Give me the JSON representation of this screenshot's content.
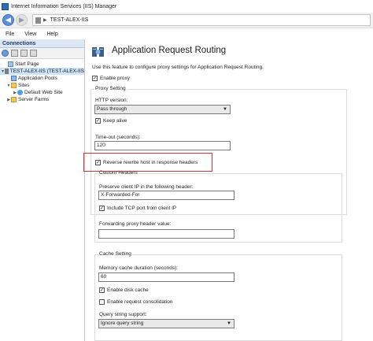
{
  "window": {
    "title": "Internet Information Services (IIS) Manager"
  },
  "address": {
    "path": "TEST-ALEX-IIS"
  },
  "menu": [
    "File",
    "View",
    "Help"
  ],
  "connections": {
    "header": "Connections",
    "tree": [
      {
        "label": "Start Page",
        "icon": "home-icon",
        "level": 1
      },
      {
        "label": "TEST-ALEX-IIS (TEST-ALEX-IIS",
        "icon": "server-icon",
        "level": 0,
        "expanded": true
      },
      {
        "label": "Application Pools",
        "icon": "app-pool-icon",
        "level": 1
      },
      {
        "label": "Sites",
        "icon": "folder-icon",
        "level": 1,
        "expanded": true
      },
      {
        "label": "Default Web Site",
        "icon": "globe-icon",
        "level": 2
      },
      {
        "label": "Server Farms",
        "icon": "folder-icon",
        "level": 1
      }
    ]
  },
  "page": {
    "title": "Application Request Routing",
    "description": "Use this feature to configure proxy settings for Application Request Routing.",
    "enable_proxy": {
      "label": "Enable proxy",
      "checked": true
    },
    "proxy_setting": {
      "legend": "Proxy Setting",
      "http_version_label": "HTTP version:",
      "http_version_value": "Pass through",
      "keep_alive": {
        "label": "Keep alive",
        "checked": true
      },
      "timeout_label": "Time-out (seconds):",
      "timeout_value": "120",
      "reverse_rewrite": {
        "label": "Reverse rewrite host in response headers",
        "checked": true
      }
    },
    "custom_headers": {
      "legend": "Custom Headers",
      "preserve_label": "Preserve client IP in the following header:",
      "preserve_value": "X-Forwarded-For",
      "include_tcp_port": {
        "label": "Include TCP port from client IP",
        "checked": true
      },
      "forwarding_label": "Forwarding proxy header value:",
      "forwarding_value": ""
    },
    "cache_setting": {
      "legend": "Cache Setting",
      "memory_label": "Memory cache duration (seconds):",
      "memory_value": "60",
      "disk_cache": {
        "label": "Enable disk cache",
        "checked": true
      },
      "request_consolidation": {
        "label": "Enable request consolidation",
        "checked": false
      },
      "query_label": "Query string support:",
      "query_value": "Ignore query string"
    }
  },
  "colors": {
    "highlight": "#d63434",
    "accent": "#2f6db5"
  }
}
